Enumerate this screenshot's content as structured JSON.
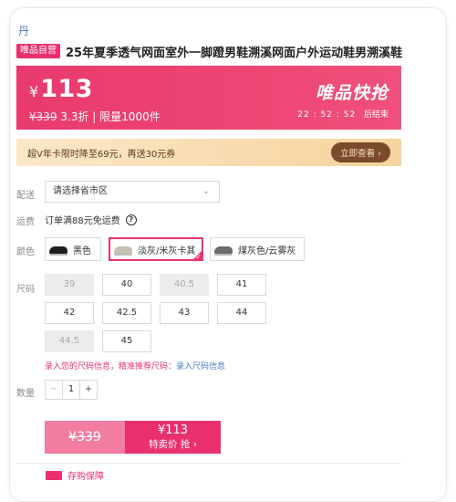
{
  "breadcrumb": "丹",
  "product": {
    "tag": "唯品自营",
    "title": "25年夏季透气网面室外一脚蹬男鞋溯溪网面户外运动鞋男溯溪鞋"
  },
  "price_banner": {
    "currency": "¥",
    "price": "113",
    "original_price": "¥339",
    "discount": "3.3折",
    "separator": "|",
    "limit": "限量1000件",
    "promo_title": "唯品快抢",
    "countdown": "22 : 52 : 52",
    "countdown_suffix": "后结束",
    "color": "#e93a6d"
  },
  "vip": {
    "text": "超V年卡限时降至69元，再送30元券",
    "button": "立即查看 ›"
  },
  "delivery": {
    "label": "配送",
    "placeholder": "请选择省市区"
  },
  "shipping": {
    "label": "运费",
    "text": "订单满88元免运费",
    "icon": "?"
  },
  "colors": {
    "label": "颜色",
    "options": [
      {
        "name": "黑色",
        "selected": false,
        "swatch": "#1e1e1e"
      },
      {
        "name": "淡灰/米灰卡其",
        "selected": true,
        "swatch": "#c9bfae"
      },
      {
        "name": "煤灰色/云雾灰",
        "selected": false,
        "swatch": "#6b6b6b"
      }
    ]
  },
  "sizes": {
    "label": "尺码",
    "items": [
      {
        "v": "39",
        "disabled": true
      },
      {
        "v": "40",
        "disabled": false
      },
      {
        "v": "40.5",
        "disabled": true
      },
      {
        "v": "41",
        "disabled": false
      },
      {
        "v": "42",
        "disabled": false
      },
      {
        "v": "42.5",
        "disabled": false
      },
      {
        "v": "43",
        "disabled": false
      },
      {
        "v": "44",
        "disabled": false
      },
      {
        "v": "44.5",
        "disabled": true
      },
      {
        "v": "45",
        "disabled": false
      }
    ],
    "hint": "录入您的尺码信息，精准推荐尺码：",
    "hint_link": "录入尺码信息"
  },
  "quantity": {
    "label": "数量",
    "minus": "−",
    "value": "1",
    "plus": "+"
  },
  "buy": {
    "old_price": "¥339",
    "price": "¥113",
    "label": "特卖价 抢 ›"
  },
  "bottom_peek": "存购保障"
}
